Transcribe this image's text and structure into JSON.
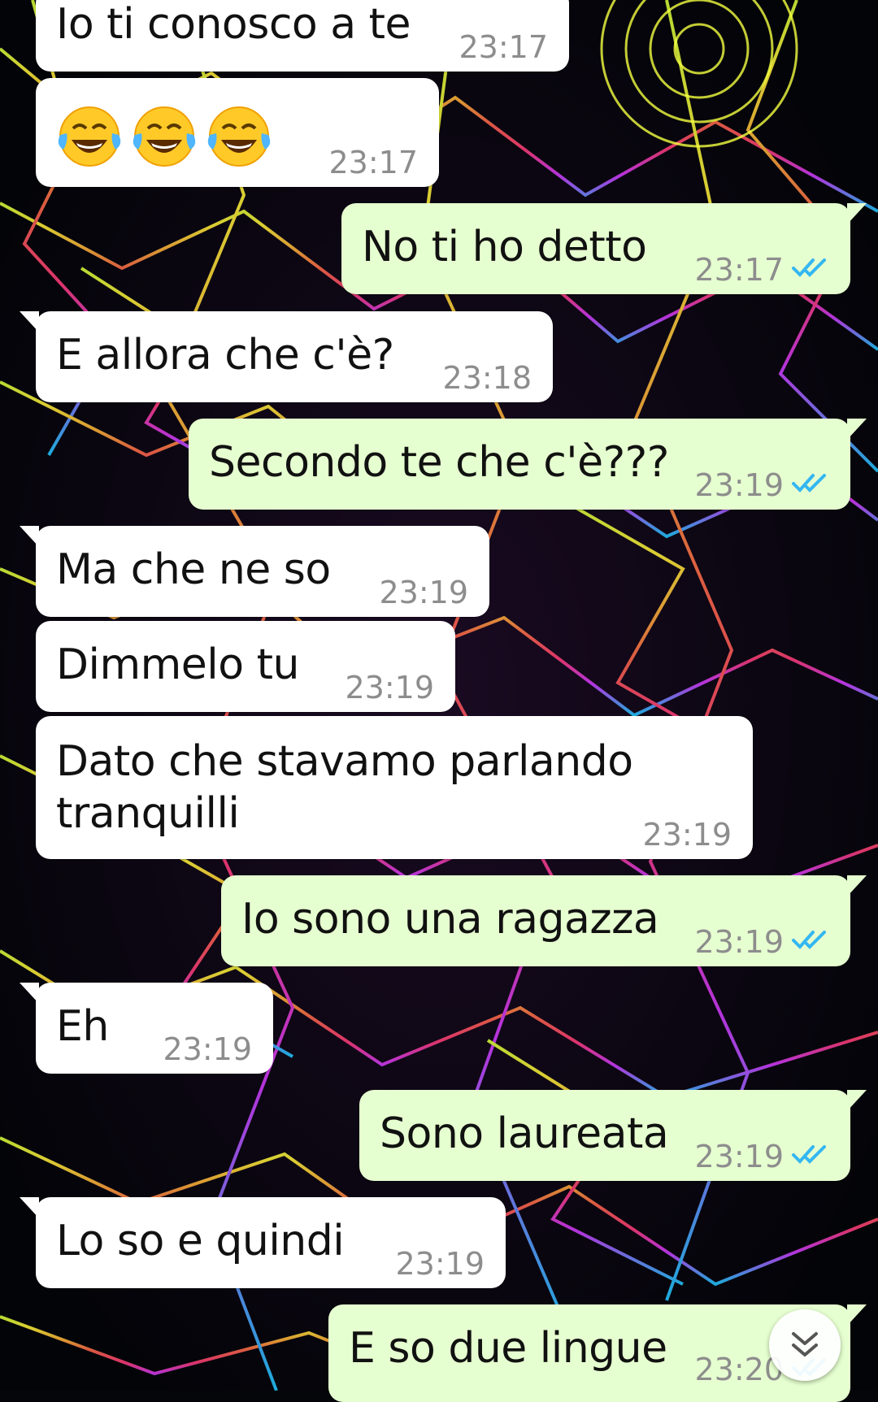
{
  "messages": [
    {
      "direction": "in",
      "text": "Io ti conosco a te",
      "time": "23:17"
    },
    {
      "direction": "in",
      "emoji": "face-with-tears-of-joy",
      "count": 3,
      "time": "23:17"
    },
    {
      "direction": "out",
      "text": "No ti ho detto",
      "time": "23:17",
      "status": "read"
    },
    {
      "direction": "in",
      "text": "E allora che c'è?",
      "time": "23:18"
    },
    {
      "direction": "out",
      "text": "Secondo te che c'è???",
      "time": "23:19",
      "status": "read"
    },
    {
      "direction": "in",
      "text": "Ma che ne so",
      "time": "23:19"
    },
    {
      "direction": "in",
      "text": "Dimmelo tu",
      "time": "23:19"
    },
    {
      "direction": "in",
      "text": "Dato che stavamo parlando tranquilli",
      "time": "23:19"
    },
    {
      "direction": "out",
      "text": "Io sono una ragazza",
      "time": "23:19",
      "status": "read"
    },
    {
      "direction": "in",
      "text": "Eh",
      "time": "23:19"
    },
    {
      "direction": "out",
      "text": "Sono laureata",
      "time": "23:19",
      "status": "read"
    },
    {
      "direction": "in",
      "text": "Lo so e quindi",
      "time": "23:19"
    },
    {
      "direction": "out",
      "text": "E so due lingue",
      "time": "23:20",
      "status": "read"
    }
  ],
  "colors": {
    "incoming_bubble": "#ffffff",
    "outgoing_bubble": "#e6ffd0",
    "timestamp": "#8d8d8d",
    "read_ticks": "#34b7f1"
  },
  "icons": {
    "read_receipt": "double-check-icon",
    "scroll_down": "double-chevron-down-icon"
  }
}
